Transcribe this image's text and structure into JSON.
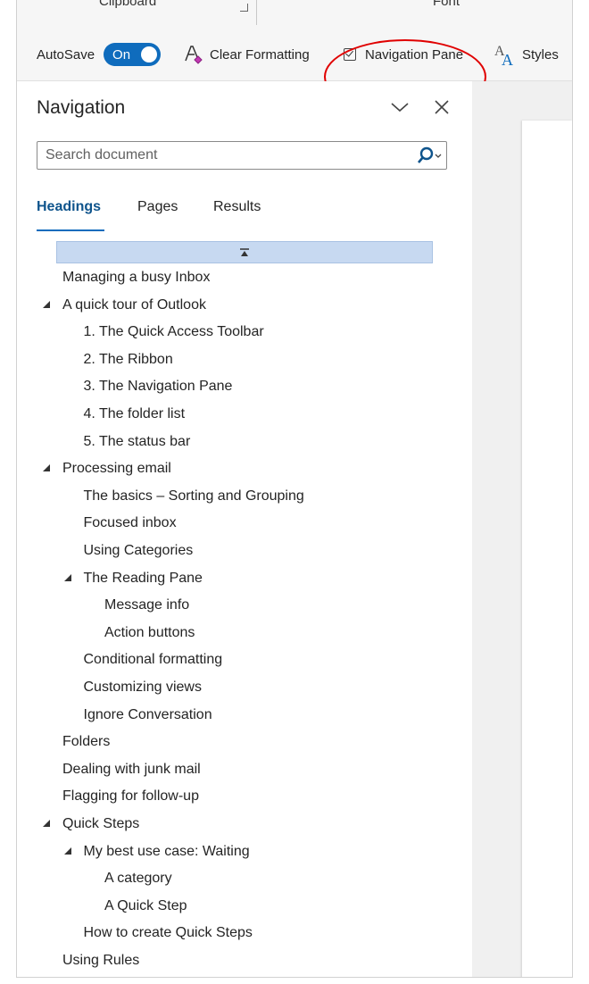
{
  "ribbon": {
    "group_labels": [
      "Clipboard",
      "Font"
    ],
    "autosave_label": "AutoSave",
    "autosave_state": "On",
    "clear_formatting_label": "Clear Formatting",
    "navigation_pane_label": "Navigation Pane",
    "navigation_pane_checked": true,
    "styles_label": "Styles"
  },
  "navigation": {
    "title": "Navigation",
    "search_placeholder": "Search document",
    "tabs": [
      {
        "label": "Headings",
        "active": true
      },
      {
        "label": "Pages",
        "active": false
      },
      {
        "label": "Results",
        "active": false
      }
    ],
    "headings": [
      {
        "label": "Managing a busy Inbox",
        "level": 1,
        "expanded": null
      },
      {
        "label": "A quick tour of Outlook",
        "level": 1,
        "expanded": true
      },
      {
        "label": "1. The Quick Access Toolbar",
        "level": 2,
        "expanded": null
      },
      {
        "label": "2. The Ribbon",
        "level": 2,
        "expanded": null
      },
      {
        "label": "3. The Navigation Pane",
        "level": 2,
        "expanded": null
      },
      {
        "label": "4. The folder list",
        "level": 2,
        "expanded": null
      },
      {
        "label": "5. The status bar",
        "level": 2,
        "expanded": null
      },
      {
        "label": "Processing email",
        "level": 1,
        "expanded": true
      },
      {
        "label": "The basics – Sorting and Grouping",
        "level": 2,
        "expanded": null
      },
      {
        "label": "Focused inbox",
        "level": 2,
        "expanded": null
      },
      {
        "label": "Using Categories",
        "level": 2,
        "expanded": null
      },
      {
        "label": "The Reading Pane",
        "level": 2,
        "expanded": true
      },
      {
        "label": "Message info",
        "level": 3,
        "expanded": null
      },
      {
        "label": "Action buttons",
        "level": 3,
        "expanded": null
      },
      {
        "label": "Conditional formatting",
        "level": 2,
        "expanded": null
      },
      {
        "label": "Customizing views",
        "level": 2,
        "expanded": null
      },
      {
        "label": "Ignore Conversation",
        "level": 2,
        "expanded": null
      },
      {
        "label": "Folders",
        "level": 1,
        "expanded": null
      },
      {
        "label": "Dealing with junk mail",
        "level": 1,
        "expanded": null
      },
      {
        "label": "Flagging for follow-up",
        "level": 1,
        "expanded": null
      },
      {
        "label": "Quick Steps",
        "level": 1,
        "expanded": true
      },
      {
        "label": "My best use case: Waiting",
        "level": 2,
        "expanded": true
      },
      {
        "label": "A category",
        "level": 3,
        "expanded": null
      },
      {
        "label": "A Quick Step",
        "level": 3,
        "expanded": null
      },
      {
        "label": "How to create Quick Steps",
        "level": 2,
        "expanded": null
      },
      {
        "label": "Using Rules",
        "level": 1,
        "expanded": null
      }
    ]
  },
  "colors": {
    "accent": "#0f6cbd",
    "active_tab_text": "#0f548c",
    "collapse_bar": "#c7d9f1",
    "annotation": "#e00000"
  },
  "icons": [
    "clear-formatting-icon",
    "checkbox-icon",
    "styles-icon",
    "chevron-down-icon",
    "close-icon",
    "search-icon",
    "collapse-all-icon",
    "expand-triangle-icon"
  ]
}
